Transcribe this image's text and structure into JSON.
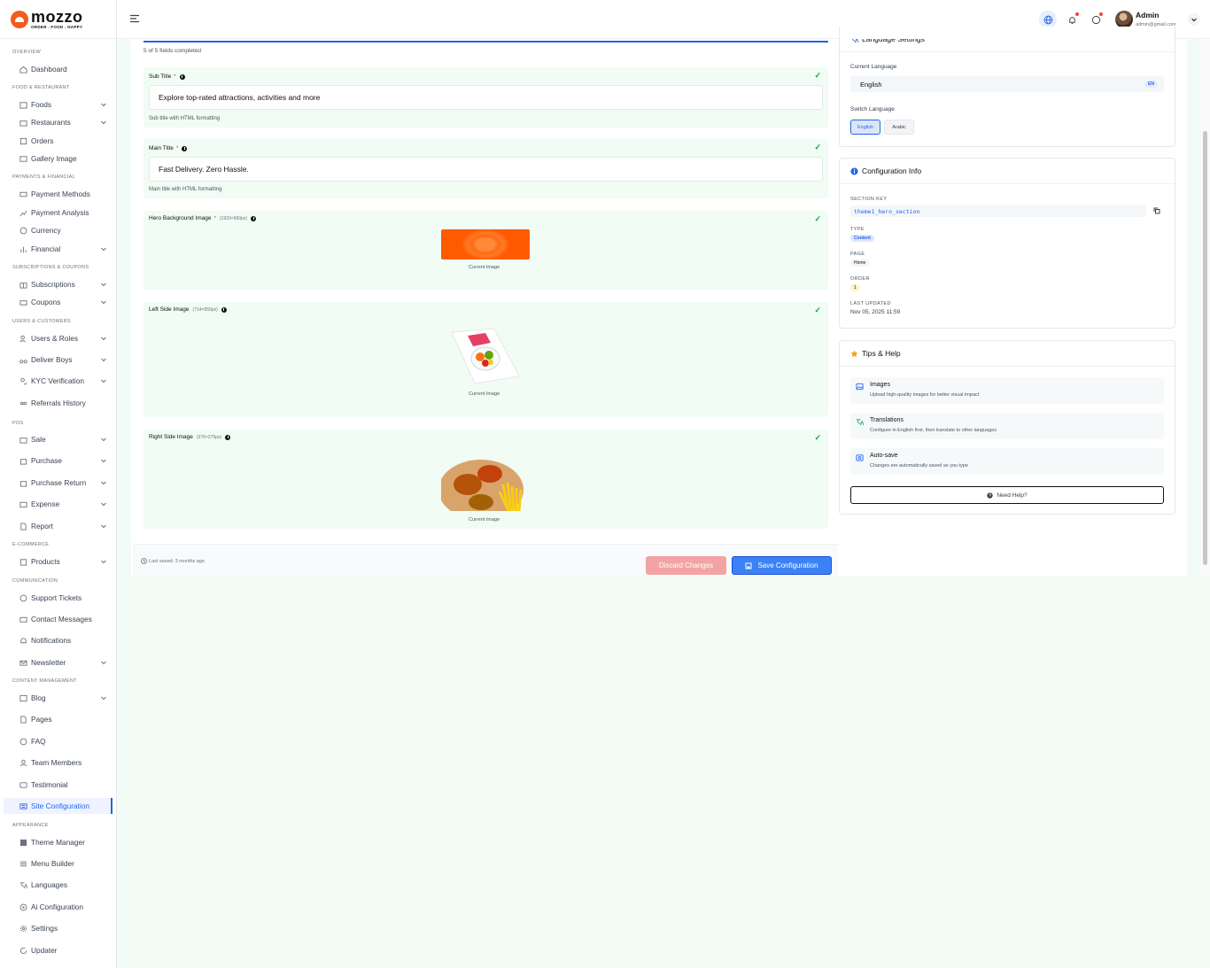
{
  "brand": {
    "name": "mozzo",
    "tagline": "ORDER . FOOD . HAPPY",
    "accent": "#f25c1d"
  },
  "header": {
    "user_name": "Admin",
    "user_email": "admin@gmail.com"
  },
  "sidebar": {
    "sections": {
      "overview": "OVERVIEW",
      "food": "FOOD & RESTAURANT",
      "payments": "PAYMENTS & FINANCIAL",
      "subs": "SUBSCRIPTIONS & COUPONS",
      "users": "USERS & CUSTOMERS",
      "pos": "POS",
      "ecom": "E-COMMERCE",
      "comm": "COMMUNICATION",
      "content": "CONTENT MANAGEMENT",
      "appearance": "APPEARANCE"
    },
    "items": {
      "dashboard": "Dashboard",
      "foods": "Foods",
      "restaurants": "Restaurants",
      "orders": "Orders",
      "gallery": "Gallery Image",
      "payment_methods": "Payment Methods",
      "payment_analysis": "Payment Analysis",
      "currency": "Currency",
      "financial": "Financial",
      "subscriptions": "Subscriptions",
      "coupons": "Coupons",
      "users_roles": "Users & Roles",
      "deliver_boys": "Deliver Boys",
      "kyc": "KYC Verification",
      "referrals": "Referrals History",
      "sale": "Sale",
      "purchase": "Purchase",
      "purchase_return": "Purchase Return",
      "expense": "Expense",
      "report": "Report",
      "products": "Products",
      "support": "Support Tickets",
      "contact": "Contact Messages",
      "notifications": "Notifications",
      "newsletter": "Newsletter",
      "blog": "Blog",
      "pages": "Pages",
      "faq": "FAQ",
      "team": "Team Members",
      "testimonial": "Testimonial",
      "site_config": "Site Configuration",
      "theme": "Theme Manager",
      "menu": "Menu Builder",
      "languages": "Languages",
      "ai_config": "Ai Configuration",
      "settings": "Settings",
      "updater": "Updater"
    }
  },
  "form": {
    "progress_text": "5 of 5 fields completed",
    "progress_fraction": 1.0,
    "sub_title": {
      "label": "Sub Title",
      "value": "Explore top-rated attractions, activities and more",
      "hint": "Sub title with HTML formatting"
    },
    "main_title": {
      "label": "Main Title",
      "value": "Fast Delivery. Zero Hassle.",
      "hint": "Main title with HTML formatting"
    },
    "hero_bg": {
      "label": "Hero Background Image",
      "size": "(1920×650px)",
      "caption": "Current Image"
    },
    "left_img": {
      "label": "Left Side Image",
      "size": "(714×650px)",
      "caption": "Current Image"
    },
    "right_img": {
      "label": "Right Side Image",
      "size": "(376×275px)",
      "caption": "Current Image"
    },
    "required_mark": "*",
    "check": "✓"
  },
  "save_bar": {
    "last_saved": "Last saved: 3 months ago",
    "discard": "Discard Changes",
    "save": "Save Configuration"
  },
  "language_card": {
    "title": "Language Settings",
    "current_label": "Current Language",
    "current_value": "English",
    "current_badge": "EN",
    "switch_label": "Switch Language",
    "options": [
      "English",
      "Arabic"
    ]
  },
  "config_card": {
    "title": "Configuration Info",
    "section_key_label": "SECTION KEY",
    "section_key": "theme1_hero_section",
    "type_label": "TYPE",
    "type": "Content",
    "page_label": "PAGE",
    "page": "Home",
    "order_label": "ORDER",
    "order": "1",
    "updated_label": "LAST UPDATED",
    "updated": "Nov 05, 2025 11:59"
  },
  "tips_card": {
    "title": "Tips & Help",
    "tips": [
      {
        "title": "Images",
        "desc": "Upload high-quality images for better visual impact"
      },
      {
        "title": "Translations",
        "desc": "Configure in English first, then translate to other languages"
      },
      {
        "title": "Auto-save",
        "desc": "Changes are automatically saved as you type"
      }
    ],
    "help": "Need Help?"
  }
}
